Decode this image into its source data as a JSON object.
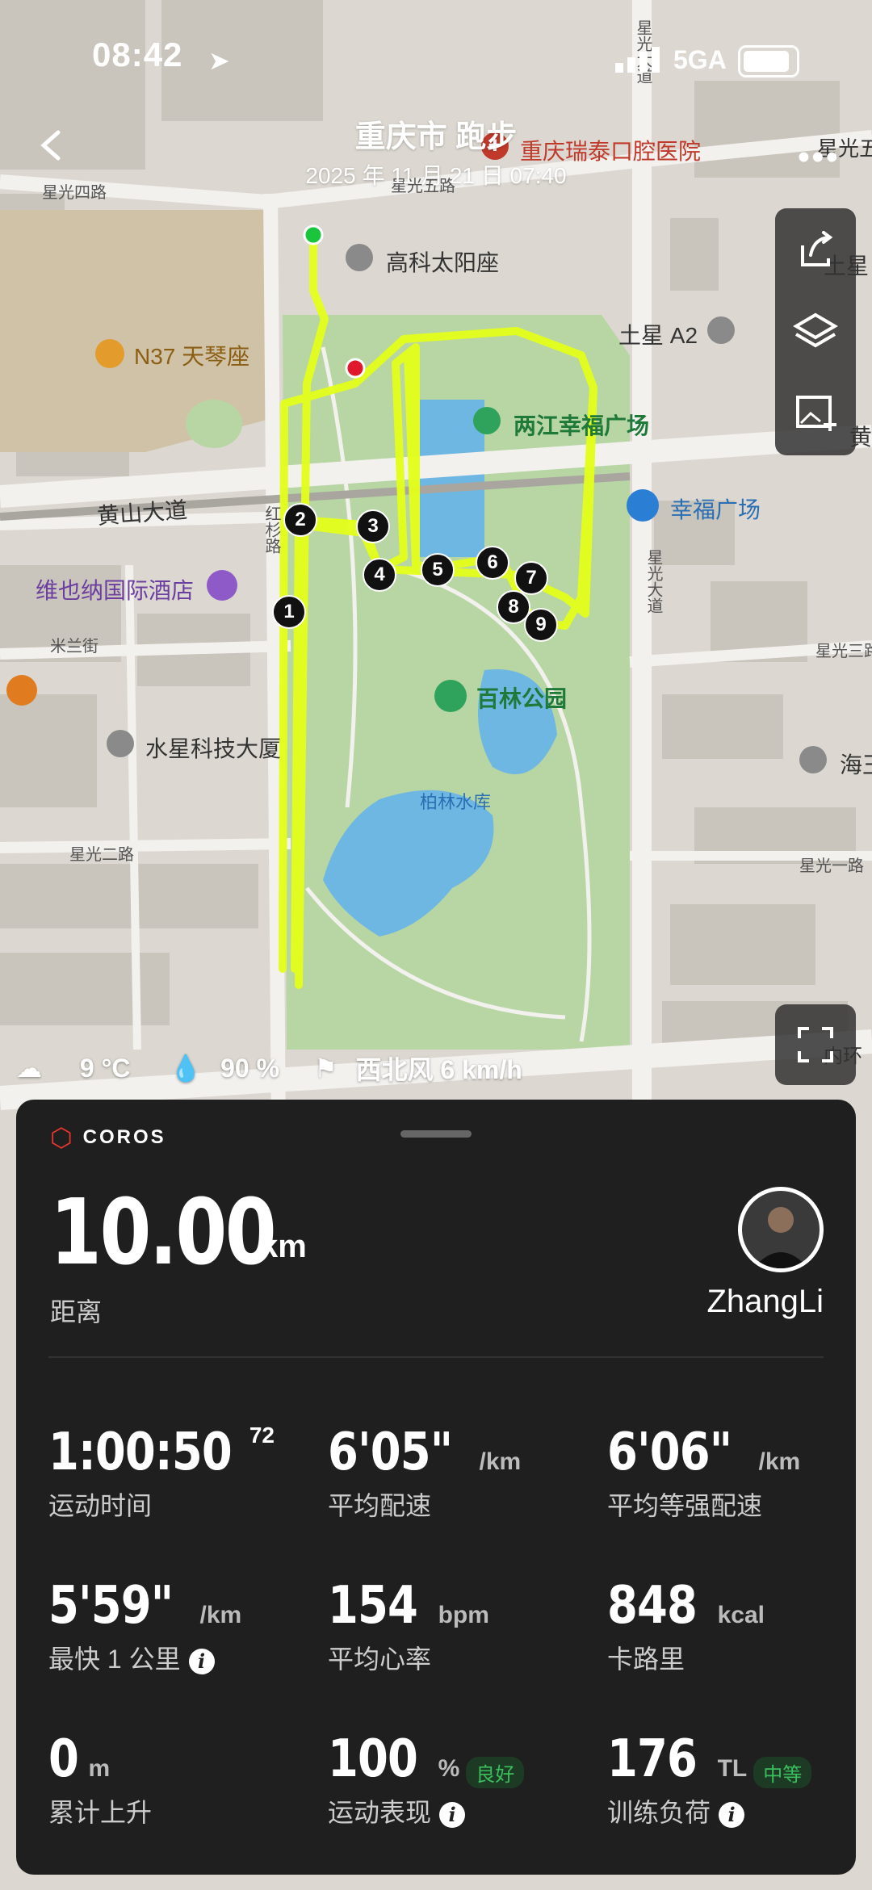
{
  "status_bar": {
    "time": "08:42",
    "network": "5GA"
  },
  "header": {
    "title": "重庆市 跑步",
    "subtitle": "2025 年 11 月 21 日 07:40"
  },
  "map": {
    "labels": {
      "xingguang_si_lu": "星光四路",
      "xingguang_wu_lu": "星光五路",
      "xingguang_top_right": "星光五",
      "huangshan_dadao": "黄山大道",
      "hongshan_lu": "红杉路",
      "mi_lan_jie": "米兰街",
      "xingguang_er_lu": "星光二路",
      "xingguang_yi_lu": "星光一路",
      "xingguang_san_lu": "星光三路",
      "xingguang_dadao_top": "星光大道",
      "xingguang_dadao_mid": "星光大道",
      "dental": "重庆瑞泰口腔医院",
      "gaoke": "高科太阳座",
      "n37": "N37 天琴座",
      "tuxing": "土星 A2",
      "tuxing_right": "土星",
      "liangjiang": "两江幸福广场",
      "xingfu": "幸福广场",
      "vienna": "维也纳国际酒店",
      "shuixing": "水星科技大厦",
      "bailin": "百林公园",
      "bailin_reservoir": "柏林水库",
      "haiwang": "海王",
      "huang": "黄",
      "neihuan": "内环"
    },
    "splits": [
      "1",
      "2",
      "3",
      "4",
      "5",
      "6",
      "7",
      "8",
      "9"
    ],
    "route_color": "#e4ff1a"
  },
  "weather": {
    "temp": "9 °C",
    "humidity": "90 %",
    "wind": "西北风 6 km/h"
  },
  "card": {
    "brand": "COROS",
    "distance_value": "10.00",
    "distance_unit": "km",
    "distance_label": "距离",
    "username": "ZhangLi",
    "stats": [
      {
        "value": "1:00:50",
        "sup": "72",
        "unit": "",
        "label": "运动时间"
      },
      {
        "value": "6'05\"",
        "unit": "/km",
        "label": "平均配速"
      },
      {
        "value": "6'06\"",
        "unit": "/km",
        "label": "平均等强配速"
      },
      {
        "value": "5'59\"",
        "unit": "/km",
        "label": "最快 1 公里"
      },
      {
        "value": "154",
        "unit": "bpm",
        "label": "平均心率"
      },
      {
        "value": "848",
        "unit": "kcal",
        "label": "卡路里"
      },
      {
        "value": "0",
        "unit": "m",
        "label": "累计上升"
      },
      {
        "value": "100",
        "unit": "%",
        "label": "运动表现",
        "badge": "良好"
      },
      {
        "value": "176",
        "unit": "TL",
        "label": "训练负荷",
        "badge": "中等"
      }
    ]
  }
}
